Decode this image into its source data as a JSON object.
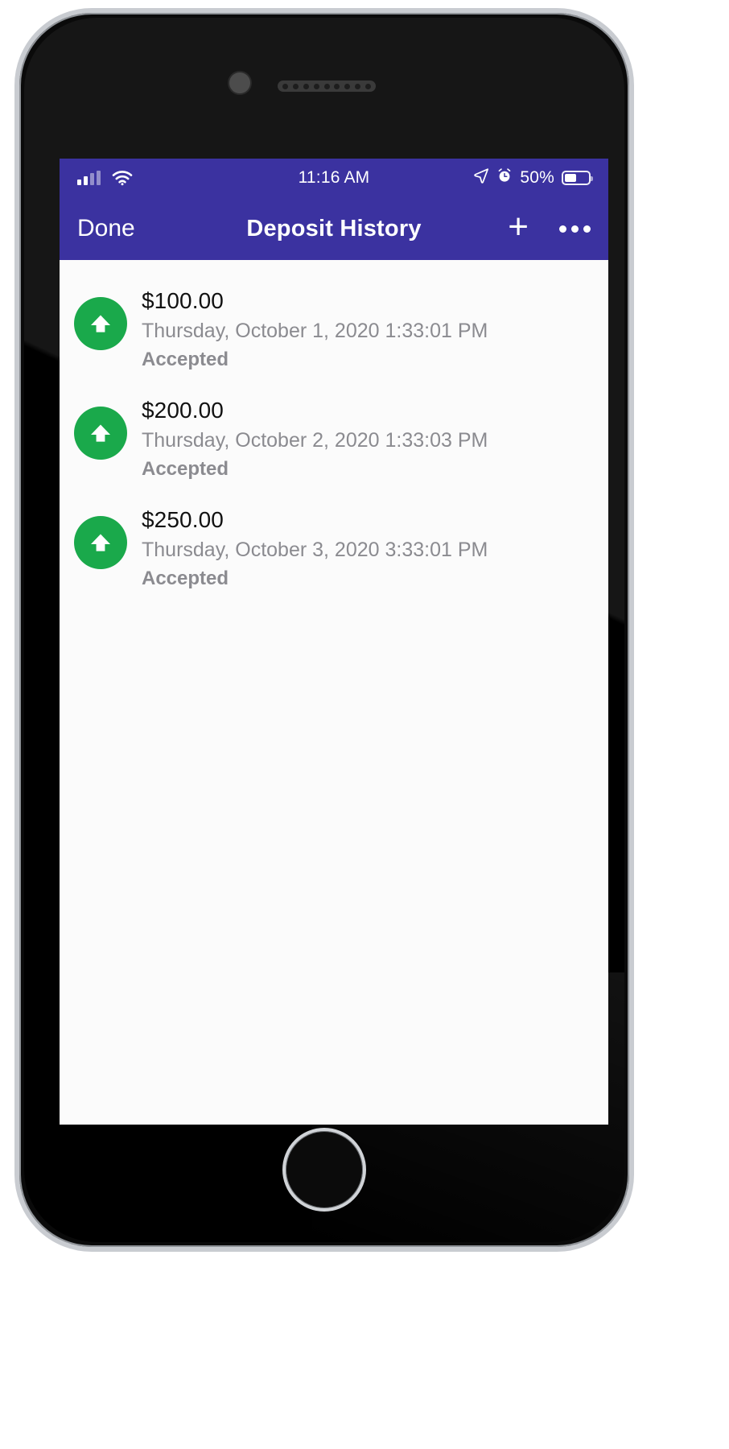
{
  "device": {
    "camera_icon": "camera-icon",
    "speaker_icon": "earpiece-speaker",
    "home_button": "home-button"
  },
  "status_bar": {
    "signal_icon": "cellular-signal-icon",
    "wifi_icon": "wifi-icon",
    "time": "11:16 AM",
    "location_icon": "location-arrow-icon",
    "alarm_icon": "alarm-clock-icon",
    "battery_percent": "50%",
    "battery_icon": "battery-icon",
    "battery_level": 50,
    "background_color": "#3b32a0",
    "foreground_color": "#ffffff"
  },
  "nav_bar": {
    "left_button": "Done",
    "title": "Deposit History",
    "add_button": "+",
    "more_button": "•••",
    "background_color": "#3b32a0"
  },
  "list": {
    "accent_color": "#1aa94b",
    "items": [
      {
        "icon": "deposit-up-arrow-icon",
        "amount": "$100.00",
        "date": "Thursday, October 1, 2020 1:33:01 PM",
        "status": "Accepted"
      },
      {
        "icon": "deposit-up-arrow-icon",
        "amount": "$200.00",
        "date": "Thursday, October 2, 2020 1:33:03 PM",
        "status": "Accepted"
      },
      {
        "icon": "deposit-up-arrow-icon",
        "amount": "$250.00",
        "date": "Thursday, October 3, 2020 3:33:01 PM",
        "status": "Accepted"
      }
    ]
  }
}
